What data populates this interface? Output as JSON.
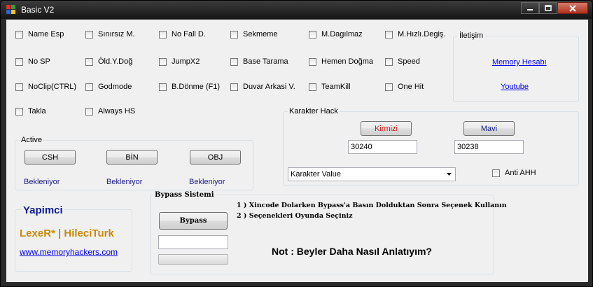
{
  "window": {
    "title": "Basic V2"
  },
  "checkboxes": {
    "name_esp": "Name Esp",
    "sinirsiz_m": "Sınırsız M.",
    "no_fall_d": "No Fall D.",
    "sekmeme": "Sekmeme",
    "m_dagilmaz": "M.Dagılmaz",
    "m_hizli_degis": "M.Hızlı.Degiş.",
    "no_sp": "No SP",
    "old_y_dog": "Öld.Y.Doğ",
    "jumpx2": "JumpX2",
    "base_tarama": "Base Tarama",
    "hemen_dogma": "Hemen Doğma",
    "speed": "Speed",
    "noclip": "NoClip(CTRL)",
    "godmode": "Godmode",
    "b_donme": "B.Dönme (F1)",
    "duvar_arkasi": "Duvar Arkasi V.",
    "teamkill": "TeamKill",
    "one_hit": "One Hit",
    "takla": "Takla",
    "always_hs": "Always HS",
    "anti_ahh": "Anti AHH"
  },
  "iletisim": {
    "label": "İletişim",
    "memory_link": "Memory Hesabı",
    "youtube_link": "Youtube"
  },
  "active": {
    "label": "Active",
    "buttons": [
      "CSH",
      "BİN",
      "OBJ"
    ],
    "status": [
      "Bekleniyor",
      "Bekleniyor",
      "Bekleniyor"
    ]
  },
  "karakter": {
    "label": "Karakter Hack",
    "red_button": "Kirmizi",
    "blue_button": "Mavi",
    "red_value": "30240",
    "blue_value": "30238",
    "dropdown_value": "Karakter Value"
  },
  "yapimci": {
    "title": "Yapimci",
    "names": "LexeR* | HileciTurk",
    "site": "www.memoryhackers.com"
  },
  "bypass": {
    "label": "Bypass Sistemi",
    "button": "Bypass",
    "input_value": "",
    "progress": 0,
    "instruction1": "1 ) Xincode Dolarken Bypass'a Basın Dolduktan Sonra Seçenek Kullanın",
    "instruction2": "2 ) Seçenekleri Oyunda Seçiniz",
    "note": "Not : Beyler Daha Nasıl Anlatıyım?"
  },
  "colors": {
    "red_button_text": "#d01010",
    "blue_button_text": "#0d1a8a",
    "yapimci_gold": "#c8890a",
    "yapimci_blue": "#0c1d8f"
  }
}
